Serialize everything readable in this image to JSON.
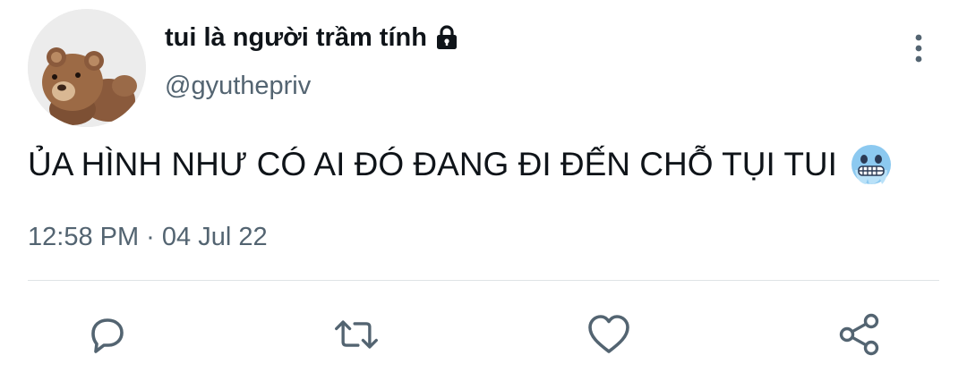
{
  "user": {
    "display_name": "tui là người trầm tính",
    "handle": "@gyuthepriv",
    "protected_icon": "lock-icon",
    "avatar_icon": "teddy-bear-avatar"
  },
  "tweet": {
    "text": "ỦA HÌNH NHƯ CÓ AI ĐÓ ĐANG ĐI ĐẾN CHỖ TỤI TUI",
    "emoji_icon": "cold-face-emoji",
    "timestamp": "12:58 PM · 04 Jul 22"
  },
  "header": {
    "more_icon": "more-vertical-icon"
  },
  "actions": [
    {
      "name": "reply",
      "icon": "reply-icon"
    },
    {
      "name": "retweet",
      "icon": "retweet-icon"
    },
    {
      "name": "like",
      "icon": "heart-icon"
    },
    {
      "name": "share",
      "icon": "share-icon"
    }
  ],
  "colors": {
    "primary_text": "#0f1419",
    "secondary_text": "#536471",
    "divider": "#dfe3e6",
    "emoji_face": "#8cc9f0"
  }
}
